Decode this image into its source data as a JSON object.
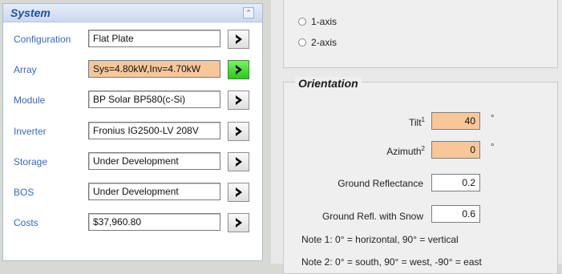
{
  "system": {
    "title": "System",
    "collapse_glyph": "⌃",
    "rows": [
      {
        "label": "Configuration",
        "value": "Flat Plate",
        "highlight": false,
        "active": false
      },
      {
        "label": "Array",
        "value": "Sys=4.80kW,Inv=4.70kW",
        "highlight": true,
        "active": true
      },
      {
        "label": "Module",
        "value": "BP Solar BP580(c-Si)",
        "highlight": false,
        "active": false
      },
      {
        "label": "Inverter",
        "value": "Fronius IG2500-LV  208V",
        "highlight": false,
        "active": false
      },
      {
        "label": "Storage",
        "value": "Under Development",
        "highlight": false,
        "active": false
      },
      {
        "label": "BOS",
        "value": "Under Development",
        "highlight": false,
        "active": false
      },
      {
        "label": "Costs",
        "value": "$37,960.80",
        "highlight": false,
        "active": false
      }
    ]
  },
  "tracking": {
    "options": [
      "1-axis",
      "2-axis"
    ]
  },
  "orientation": {
    "title": "Orientation",
    "tilt": {
      "label": "Tilt",
      "sup": "1",
      "value": "40",
      "unit": "°"
    },
    "azimuth": {
      "label": "Azimuth",
      "sup": "2",
      "value": "0",
      "unit": "°"
    },
    "ground_reflectance": {
      "label": "Ground Reflectance",
      "value": "0.2"
    },
    "ground_refl_snow": {
      "label": "Ground Refl. with Snow",
      "value": "0.6"
    },
    "note1": "Note 1:  0° = horizontal, 90° = vertical",
    "note2": "Note 2:  0° = south, 90° = west, -90° = east"
  },
  "colors": {
    "highlight": "#f7c79a",
    "active_button": "#2bc71a",
    "label_blue": "#3a68c0",
    "header_blue": "#1f4ea8"
  }
}
